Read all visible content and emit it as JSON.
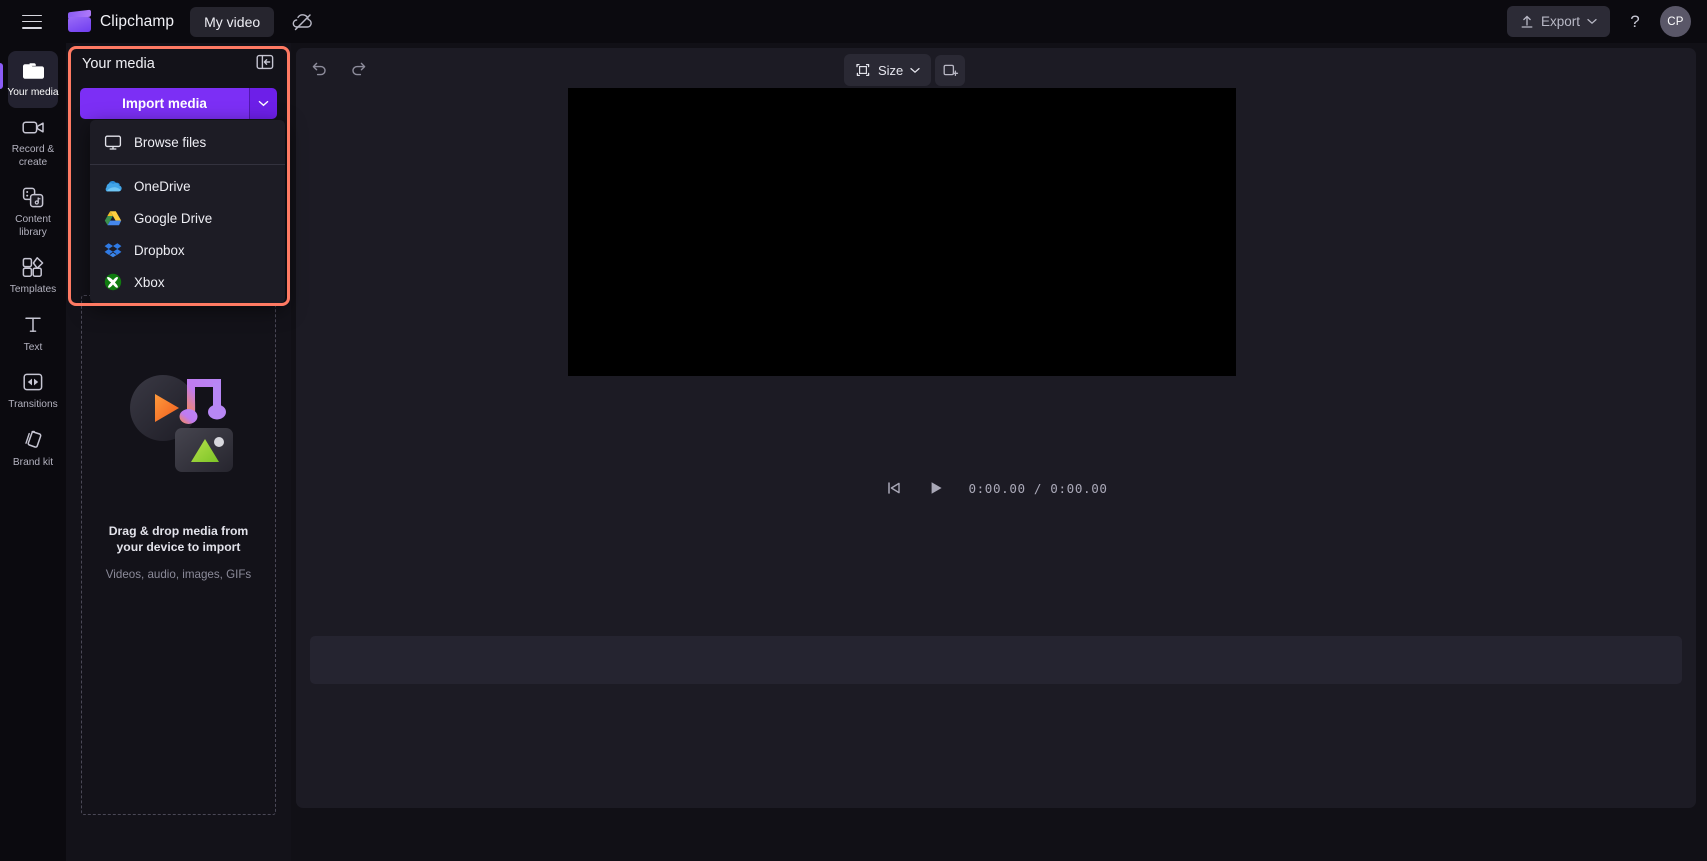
{
  "app": {
    "brand_name": "Clipchamp",
    "project_name": "My video"
  },
  "topbar": {
    "menu_icon": "hamburger-icon",
    "logo_icon": "clipchamp-logo-icon",
    "cloud_off_icon": "cloud-off-icon",
    "export_label": "Export",
    "export_icon": "upload-arrow-icon",
    "help_label": "?",
    "avatar_initials": "CP"
  },
  "sidebar": {
    "items": [
      {
        "label": "Your media",
        "icon": "folder-icon",
        "active": true
      },
      {
        "label": "Record & create",
        "icon": "video-camera-icon",
        "active": false
      },
      {
        "label": "Content library",
        "icon": "content-library-icon",
        "active": false
      },
      {
        "label": "Templates",
        "icon": "templates-grid-icon",
        "active": false
      },
      {
        "label": "Text",
        "icon": "text-t-icon",
        "active": false
      },
      {
        "label": "Transitions",
        "icon": "transitions-icon",
        "active": false
      },
      {
        "label": "Brand kit",
        "icon": "brand-kit-icon",
        "active": false
      }
    ]
  },
  "media_panel": {
    "title": "Your media",
    "collapse_icon": "collapse-panel-icon",
    "import_label": "Import media",
    "import_caret_icon": "chevron-down-icon",
    "dropzone": {
      "headline": "Drag & drop media from your device to import",
      "subtext": "Videos, audio, images, GIFs"
    }
  },
  "import_menu": {
    "items": [
      {
        "label": "Browse files",
        "icon": "monitor-icon"
      },
      {
        "label": "OneDrive",
        "icon": "onedrive-icon"
      },
      {
        "label": "Google Drive",
        "icon": "google-drive-icon"
      },
      {
        "label": "Dropbox",
        "icon": "dropbox-icon"
      },
      {
        "label": "Xbox",
        "icon": "xbox-icon"
      }
    ]
  },
  "editor": {
    "undo_icon": "undo-icon",
    "redo_icon": "redo-icon",
    "size_label": "Size",
    "size_icon": "crop-frame-icon",
    "size_caret_icon": "chevron-down-icon",
    "aspect_icon": "add-frame-icon",
    "playback": {
      "skip_start_icon": "skip-to-start-icon",
      "play_icon": "play-icon",
      "time_current": "0:00.00",
      "time_separator": "/",
      "time_total": "0:00.00"
    }
  },
  "colors": {
    "accent_purple": "#7c2ff5",
    "accent_purple_dark": "#6d1fe8",
    "highlight_orange": "#ff7a63",
    "panel_bg": "#131219",
    "stage_bg": "#1c1b24"
  }
}
